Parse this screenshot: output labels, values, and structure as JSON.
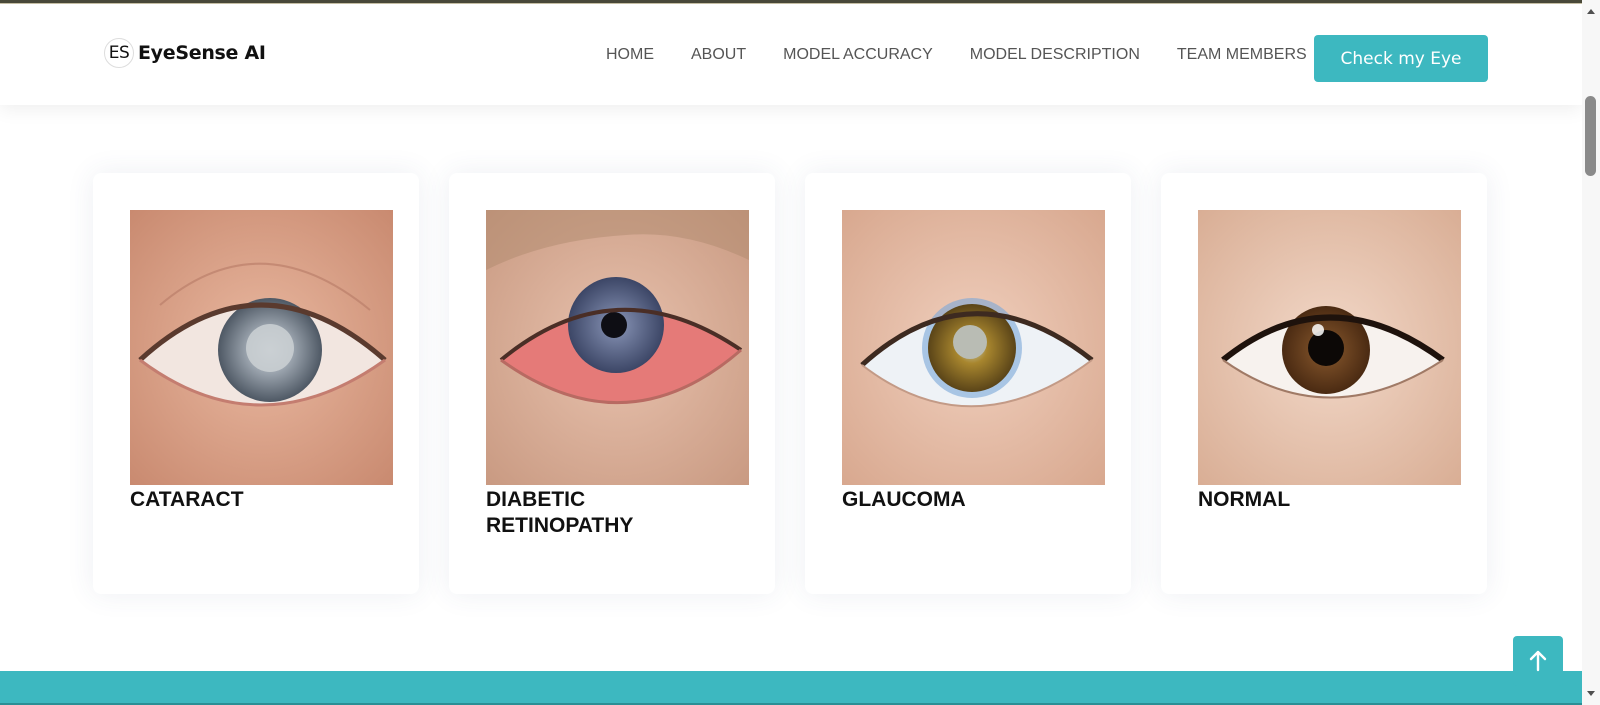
{
  "brand": {
    "badge": "ES",
    "name": "EyeSense AI"
  },
  "nav": {
    "items": [
      {
        "label": "HOME"
      },
      {
        "label": "ABOUT"
      },
      {
        "label": "MODEL ACCURACY"
      },
      {
        "label": "MODEL DESCRIPTION"
      },
      {
        "label": "TEAM MEMBERS"
      }
    ],
    "cta_label": "Check my Eye"
  },
  "cards": [
    {
      "title": "CATARACT",
      "image": "cataract-eye-photo"
    },
    {
      "title": "DIABETIC RETINOPATHY",
      "image": "diabetic-retinopathy-eye-photo"
    },
    {
      "title": "GLAUCOMA",
      "image": "glaucoma-eye-photo"
    },
    {
      "title": "NORMAL",
      "image": "normal-eye-photo"
    }
  ],
  "icons": {
    "back_to_top": "arrow-up-icon",
    "scroll_up": "scroll-up-arrow",
    "scroll_down": "scroll-down-arrow"
  },
  "colors": {
    "accent": "#3db8c0",
    "nav_text": "#555555",
    "title_text": "#111111"
  }
}
